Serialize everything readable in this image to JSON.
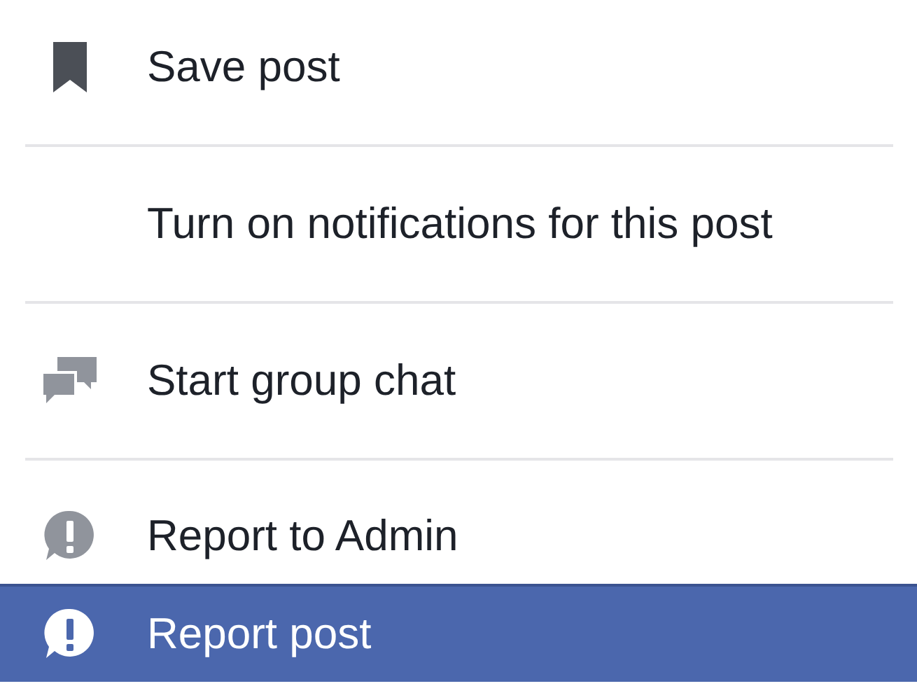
{
  "menu": {
    "items": [
      {
        "label": "Save post",
        "kind": "bookmark",
        "selected": false
      },
      {
        "label": "Turn on notifications for this post",
        "kind": "plain",
        "selected": false
      },
      {
        "label": "Start group chat",
        "kind": "chat",
        "selected": false
      },
      {
        "label": "Report to Admin",
        "kind": "alert",
        "selected": false
      },
      {
        "label": "Report post",
        "kind": "alert",
        "selected": true
      }
    ]
  }
}
